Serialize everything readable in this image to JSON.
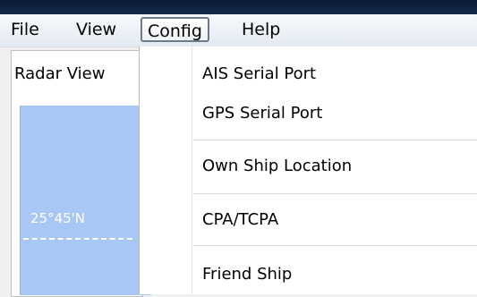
{
  "menubar": {
    "items": [
      "File",
      "View",
      "Config",
      "Help"
    ],
    "active": "Config"
  },
  "sidebar": {
    "tab_label": "Radar View",
    "latitude_label": "25°45'N"
  },
  "config_menu": {
    "items": [
      "AIS Serial Port",
      "GPS Serial Port",
      "Own Ship Location",
      "CPA/TCPA",
      "Friend Ship"
    ]
  },
  "colors": {
    "radar_background": "#a9c7f5",
    "titlebar": "#142a4c"
  }
}
